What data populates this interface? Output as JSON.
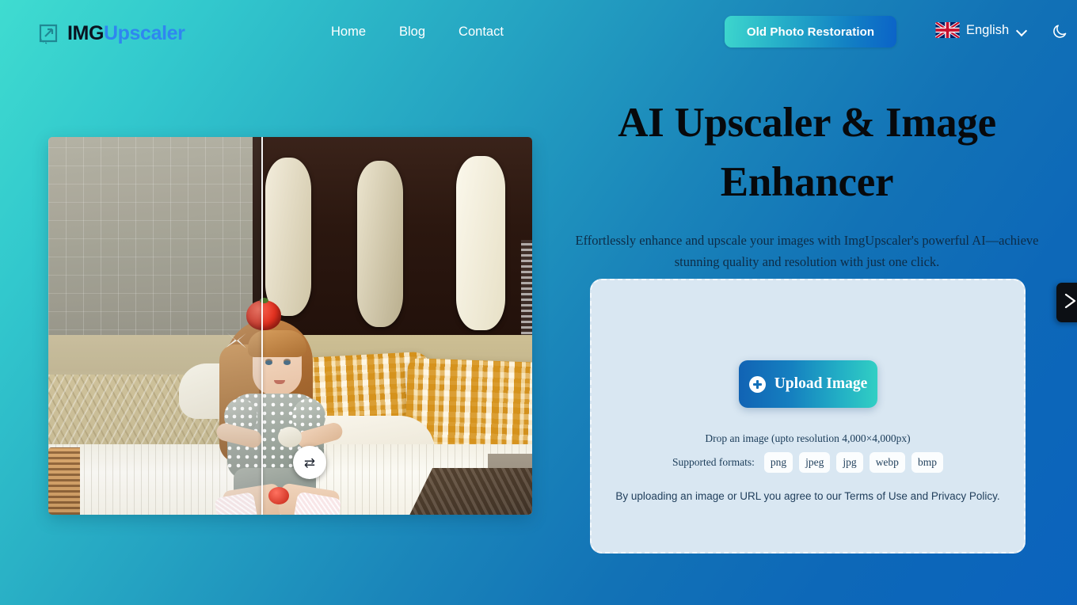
{
  "theme": {
    "bg_from": "#3fdcd0",
    "bg_to": "#0b63bd",
    "card_bg": "#d9e7f2",
    "accent_blue": "#1170b9",
    "accent_teal": "#31cfc4",
    "heading_color": "#07090c"
  },
  "header": {
    "brand": {
      "icon": "image-upscale-icon",
      "text_primary": "IMG",
      "text_secondary": "Upscaler"
    },
    "nav": [
      {
        "label": "Home",
        "name": "nav-link-home"
      },
      {
        "label": "Blog",
        "name": "nav-link-blog"
      },
      {
        "label": "Contact",
        "name": "nav-link-contact"
      }
    ],
    "cta": {
      "label": "Old Photo Restoration",
      "icon": "none"
    },
    "language": {
      "flag": "uk-flag-icon",
      "label": "English",
      "chevron": "chevron-down-icon"
    },
    "theme_toggle": {
      "icon": "moon-icon",
      "state": "light"
    }
  },
  "comparison": {
    "handle_icon": "swap-horizontal-icon",
    "handle_glyph": "⇄",
    "divider_position_pct": 44,
    "before_label": "",
    "after_label": ""
  },
  "hero": {
    "title": "AI Upscaler & Image Enhancer",
    "subtitle": "Effortlessly enhance and upscale your images with ImgUpscaler's powerful AI—achieve stunning quality and resolution with just one click."
  },
  "upload": {
    "button_label": "Upload Image",
    "button_icon": "plus-circle-icon",
    "drop_hint": "Drop an image (upto resolution 4,000×4,000px)",
    "formats_label": "Supported formats:",
    "formats": [
      "png",
      "jpeg",
      "jpg",
      "webp",
      "bmp"
    ],
    "terms_note": "By uploading an image or URL you agree to our Terms of Use and Privacy Policy."
  },
  "edge_tab": {
    "icon": "chevron-right-icon",
    "label": ""
  }
}
